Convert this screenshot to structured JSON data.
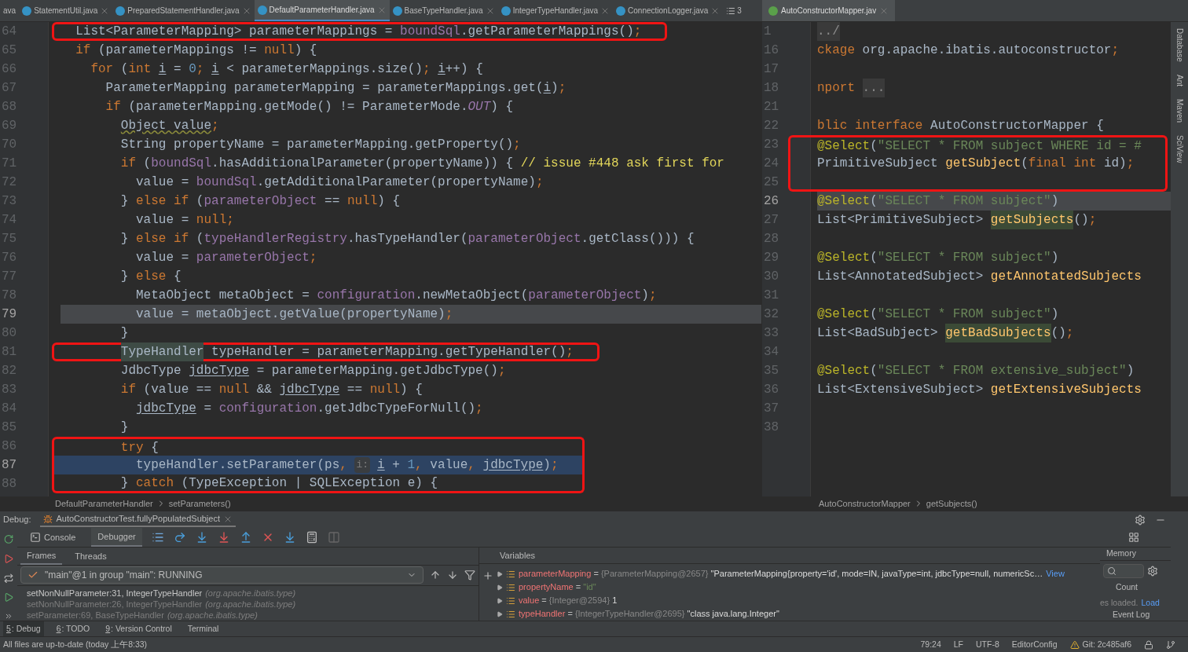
{
  "editor_tabs": [
    {
      "label": "ava",
      "selected": false,
      "icon": false
    },
    {
      "label": "StatementUtil.java",
      "selected": false,
      "icon": true
    },
    {
      "label": "PreparedStatementHandler.java",
      "selected": false,
      "icon": true
    },
    {
      "label": "DefaultParameterHandler.java",
      "selected": true,
      "icon": true
    },
    {
      "label": "BaseTypeHandler.java",
      "selected": false,
      "icon": true
    },
    {
      "label": "IntegerTypeHandler.java",
      "selected": false,
      "icon": true
    },
    {
      "label": "ConnectionLogger.java",
      "selected": false,
      "icon": true
    }
  ],
  "tabs_overflow": "3",
  "right_tab": {
    "label": "AutoConstructorMapper.jav",
    "selected": true
  },
  "left_editor": {
    "lines": [
      {
        "n": "64",
        "caret": false,
        "paused": false,
        "boxed": true,
        "tokens": [
          {
            "kind": "plain",
            "text": "List<ParameterMapping> parameterMappings = "
          },
          {
            "kind": "field",
            "text": "boundSql"
          },
          {
            "kind": "plain",
            "text": ".getParameterMappings()"
          },
          {
            "kind": "kw",
            "text": ";"
          }
        ]
      },
      {
        "n": "65",
        "caret": false,
        "paused": false,
        "boxed": false,
        "tokens": [
          {
            "kind": "kw",
            "text": "if"
          },
          {
            "kind": "plain",
            "text": " (parameterMappings != "
          },
          {
            "kind": "kw",
            "text": "null"
          },
          {
            "kind": "plain",
            "text": ") {"
          }
        ],
        "children": [
          {
            "n": "66",
            "caret": false,
            "paused": false,
            "boxed": false,
            "tokens": [
              {
                "kind": "kw",
                "text": "for"
              },
              {
                "kind": "plain",
                "text": " ("
              },
              {
                "kind": "kw",
                "text": "int "
              },
              {
                "kind": "uvar",
                "text": "i"
              },
              {
                "kind": "plain",
                "text": " = "
              },
              {
                "kind": "num",
                "text": "0"
              },
              {
                "kind": "kw",
                "text": "; "
              },
              {
                "kind": "uvar",
                "text": "i"
              },
              {
                "kind": "plain",
                "text": " < parameterMappings.size()"
              },
              {
                "kind": "kw",
                "text": "; "
              },
              {
                "kind": "uvar",
                "text": "i"
              },
              {
                "kind": "plain",
                "text": "++) {"
              }
            ],
            "children": [
              {
                "n": "67",
                "caret": false,
                "paused": false,
                "boxed": false,
                "tokens": [
                  {
                    "kind": "plain",
                    "text": "ParameterMapping parameterMapping = parameterMappings.get("
                  },
                  {
                    "kind": "uvar",
                    "text": "i"
                  },
                  {
                    "kind": "plain",
                    "text": ")"
                  },
                  {
                    "kind": "kw",
                    "text": ";"
                  }
                ]
              },
              {
                "n": "68",
                "caret": false,
                "paused": false,
                "boxed": false,
                "tokens": [
                  {
                    "kind": "kw",
                    "text": "if"
                  },
                  {
                    "kind": "plain",
                    "text": " (parameterMapping.getMode() != ParameterMode."
                  },
                  {
                    "kind": "fieldi",
                    "text": "OUT"
                  },
                  {
                    "kind": "plain",
                    "text": ") {"
                  }
                ],
                "children": [
                  {
                    "n": "69",
                    "caret": false,
                    "paused": false,
                    "boxed": false,
                    "tokens": [
                      {
                        "kind": "warn",
                        "text": "Object value"
                      },
                      {
                        "kind": "kw",
                        "text": ";"
                      }
                    ]
                  },
                  {
                    "n": "70",
                    "caret": false,
                    "paused": false,
                    "boxed": false,
                    "tokens": [
                      {
                        "kind": "plain",
                        "text": "String propertyName = parameterMapping.getProperty()"
                      },
                      {
                        "kind": "kw",
                        "text": ";"
                      }
                    ]
                  },
                  {
                    "n": "71",
                    "caret": false,
                    "paused": false,
                    "boxed": false,
                    "tokens": [
                      {
                        "kind": "kw",
                        "text": "if"
                      },
                      {
                        "kind": "plain",
                        "text": " ("
                      },
                      {
                        "kind": "field",
                        "text": "boundSql"
                      },
                      {
                        "kind": "plain",
                        "text": ".hasAdditionalParameter(propertyName)) { "
                      },
                      {
                        "kind": "todo",
                        "text": "// issue #448 ask first for"
                      }
                    ],
                    "children": [
                      {
                        "n": "72",
                        "caret": false,
                        "paused": false,
                        "boxed": false,
                        "tokens": [
                          {
                            "kind": "plain",
                            "text": "value = "
                          },
                          {
                            "kind": "field",
                            "text": "boundSql"
                          },
                          {
                            "kind": "plain",
                            "text": ".getAdditionalParameter(propertyName)"
                          },
                          {
                            "kind": "kw",
                            "text": ";"
                          }
                        ]
                      }
                    ]
                  },
                  {
                    "n": "73",
                    "caret": false,
                    "paused": false,
                    "boxed": false,
                    "tokens": [
                      {
                        "kind": "plain",
                        "text": "} "
                      },
                      {
                        "kind": "kw",
                        "text": "else if"
                      },
                      {
                        "kind": "plain",
                        "text": " ("
                      },
                      {
                        "kind": "field",
                        "text": "parameterObject"
                      },
                      {
                        "kind": "plain",
                        "text": " == "
                      },
                      {
                        "kind": "kw",
                        "text": "null"
                      },
                      {
                        "kind": "plain",
                        "text": ") {"
                      }
                    ],
                    "children": [
                      {
                        "n": "74",
                        "caret": false,
                        "paused": false,
                        "boxed": false,
                        "tokens": [
                          {
                            "kind": "plain",
                            "text": "value = "
                          },
                          {
                            "kind": "kw",
                            "text": "null;"
                          }
                        ]
                      }
                    ]
                  },
                  {
                    "n": "75",
                    "caret": false,
                    "paused": false,
                    "boxed": false,
                    "tokens": [
                      {
                        "kind": "plain",
                        "text": "} "
                      },
                      {
                        "kind": "kw",
                        "text": "else if"
                      },
                      {
                        "kind": "plain",
                        "text": " ("
                      },
                      {
                        "kind": "field",
                        "text": "typeHandlerRegistry"
                      },
                      {
                        "kind": "plain",
                        "text": ".hasTypeHandler("
                      },
                      {
                        "kind": "field",
                        "text": "parameterObject"
                      },
                      {
                        "kind": "plain",
                        "text": ".getClass())) {"
                      }
                    ],
                    "children": [
                      {
                        "n": "76",
                        "caret": false,
                        "paused": false,
                        "boxed": false,
                        "tokens": [
                          {
                            "kind": "plain",
                            "text": "value = "
                          },
                          {
                            "kind": "field",
                            "text": "parameterObject"
                          },
                          {
                            "kind": "kw",
                            "text": ";"
                          }
                        ]
                      }
                    ]
                  },
                  {
                    "n": "77",
                    "caret": false,
                    "paused": false,
                    "boxed": false,
                    "tokens": [
                      {
                        "kind": "plain",
                        "text": "} "
                      },
                      {
                        "kind": "kw",
                        "text": "else"
                      },
                      {
                        "kind": "plain",
                        "text": " {"
                      }
                    ],
                    "children": [
                      {
                        "n": "78",
                        "caret": false,
                        "paused": false,
                        "boxed": false,
                        "tokens": [
                          {
                            "kind": "plain",
                            "text": "MetaObject metaObject = "
                          },
                          {
                            "kind": "field",
                            "text": "configuration"
                          },
                          {
                            "kind": "plain",
                            "text": ".newMetaObject("
                          },
                          {
                            "kind": "field",
                            "text": "parameterObject"
                          },
                          {
                            "kind": "plain",
                            "text": ")"
                          },
                          {
                            "kind": "kw",
                            "text": ";"
                          }
                        ]
                      },
                      {
                        "n": "79",
                        "caret": true,
                        "paused": false,
                        "boxed": false,
                        "tokens": [
                          {
                            "kind": "plain",
                            "text": "value = metaObject.getValue(propertyName)"
                          },
                          {
                            "kind": "kw",
                            "text": ";"
                          }
                        ]
                      }
                    ]
                  },
                  {
                    "n": "80",
                    "caret": false,
                    "paused": false,
                    "boxed": false,
                    "tokens": [
                      {
                        "kind": "plain",
                        "text": "}"
                      }
                    ]
                  },
                  {
                    "n": "81",
                    "caret": false,
                    "paused": false,
                    "boxed": true,
                    "tokens": [
                      {
                        "kind": "hl",
                        "text": "TypeHandler"
                      },
                      {
                        "kind": "plain",
                        "text": " typeHandler = parameterMapping.getTypeHandler()"
                      },
                      {
                        "kind": "kw",
                        "text": ";"
                      }
                    ]
                  },
                  {
                    "n": "82",
                    "caret": false,
                    "paused": false,
                    "boxed": false,
                    "tokens": [
                      {
                        "kind": "plain",
                        "text": "JdbcType "
                      },
                      {
                        "kind": "uvar",
                        "text": "jdbcType"
                      },
                      {
                        "kind": "plain",
                        "text": " = parameterMapping.getJdbcType()"
                      },
                      {
                        "kind": "kw",
                        "text": ";"
                      }
                    ]
                  },
                  {
                    "n": "83",
                    "caret": false,
                    "paused": false,
                    "boxed": false,
                    "tokens": [
                      {
                        "kind": "kw",
                        "text": "if"
                      },
                      {
                        "kind": "plain",
                        "text": " (value == "
                      },
                      {
                        "kind": "kw",
                        "text": "null"
                      },
                      {
                        "kind": "plain",
                        "text": " && "
                      },
                      {
                        "kind": "uvar",
                        "text": "jdbcType"
                      },
                      {
                        "kind": "plain",
                        "text": " == "
                      },
                      {
                        "kind": "kw",
                        "text": "null"
                      },
                      {
                        "kind": "plain",
                        "text": ") {"
                      }
                    ],
                    "children": [
                      {
                        "n": "84",
                        "caret": false,
                        "paused": false,
                        "boxed": false,
                        "tokens": [
                          {
                            "kind": "uvar",
                            "text": "jdbcType"
                          },
                          {
                            "kind": "plain",
                            "text": " = "
                          },
                          {
                            "kind": "field",
                            "text": "configuration"
                          },
                          {
                            "kind": "plain",
                            "text": ".getJdbcTypeForNull()"
                          },
                          {
                            "kind": "kw",
                            "text": ";"
                          }
                        ]
                      }
                    ]
                  },
                  {
                    "n": "85",
                    "caret": false,
                    "paused": false,
                    "boxed": false,
                    "tokens": [
                      {
                        "kind": "plain",
                        "text": "}"
                      }
                    ]
                  },
                  {
                    "n": "86",
                    "caret": false,
                    "paused": false,
                    "boxed": true,
                    "tokens": [
                      {
                        "kind": "kw",
                        "text": "try"
                      },
                      {
                        "kind": "plain",
                        "text": " {"
                      }
                    ],
                    "children": [
                      {
                        "n": "87",
                        "caret": false,
                        "paused": true,
                        "boxed": true,
                        "tokens": [
                          {
                            "kind": "plain",
                            "text": "typeHandler.setParameter(ps"
                          },
                          {
                            "kind": "kw",
                            "text": ", "
                          },
                          {
                            "kind": "hint",
                            "text": "i:"
                          },
                          {
                            "kind": "uvar",
                            "text": "i"
                          },
                          {
                            "kind": "plain",
                            "text": " + "
                          },
                          {
                            "kind": "num",
                            "text": "1"
                          },
                          {
                            "kind": "kw",
                            "text": ", "
                          },
                          {
                            "kind": "plain",
                            "text": "value"
                          },
                          {
                            "kind": "kw",
                            "text": ", "
                          },
                          {
                            "kind": "uvar",
                            "text": "jdbcType"
                          },
                          {
                            "kind": "plain",
                            "text": ")"
                          },
                          {
                            "kind": "kw",
                            "text": ";"
                          }
                        ]
                      }
                    ]
                  },
                  {
                    "n": "88",
                    "caret": false,
                    "paused": false,
                    "boxed": true,
                    "tokens": [
                      {
                        "kind": "plain",
                        "text": "} "
                      },
                      {
                        "kind": "kw",
                        "text": "catch"
                      },
                      {
                        "kind": "plain",
                        "text": " (TypeException | SQLException e) {"
                      }
                    ]
                  }
                ]
              }
            ]
          }
        ]
      }
    ],
    "breadcrumb": [
      "DefaultParameterHandler",
      "setParameters()"
    ]
  },
  "right_editor": {
    "lines": [
      {
        "n": "1",
        "caret": false,
        "paused": false,
        "boxed": false,
        "tokens": [
          {
            "kind": "fold",
            "text": "../"
          }
        ]
      },
      {
        "n": "16",
        "caret": false,
        "paused": false,
        "boxed": false,
        "tokens": [
          {
            "kind": "kw",
            "text": "ckage"
          },
          {
            "kind": "plain",
            "text": " org.apache.ibatis.autoconstructor"
          },
          {
            "kind": "kw",
            "text": ";"
          }
        ]
      },
      {
        "n": "17"
      },
      {
        "n": "18",
        "caret": false,
        "paused": false,
        "boxed": false,
        "tokens": [
          {
            "kind": "kw",
            "text": "nport "
          },
          {
            "kind": "fold",
            "text": "..."
          }
        ]
      },
      {
        "n": "21"
      },
      {
        "n": "22",
        "caret": false,
        "paused": false,
        "boxed": false,
        "tokens": [
          {
            "kind": "kw",
            "text": "blic interface"
          },
          {
            "kind": "plain",
            "text": " AutoConstructorMapper {"
          }
        ]
      },
      {
        "n": "23",
        "caret": false,
        "paused": false,
        "boxed": true,
        "tokens": [
          {
            "kind": "ann",
            "text": "@Select"
          },
          {
            "kind": "plain",
            "text": "("
          },
          {
            "kind": "str",
            "text": "\"SELECT * FROM subject WHERE id = #"
          }
        ]
      },
      {
        "n": "24",
        "caret": false,
        "paused": false,
        "boxed": true,
        "tokens": [
          {
            "kind": "plain",
            "text": "PrimitiveSubject "
          },
          {
            "kind": "method",
            "text": "getSubject"
          },
          {
            "kind": "plain",
            "text": "("
          },
          {
            "kind": "kw",
            "text": "final int"
          },
          {
            "kind": "plain",
            "text": " id)"
          },
          {
            "kind": "kw",
            "text": ";"
          }
        ]
      },
      {
        "n": "25",
        "boxed": true
      },
      {
        "n": "26",
        "caret": true,
        "paused": false,
        "boxed": false,
        "tokens": [
          {
            "kind": "ann",
            "text": "@Select"
          },
          {
            "kind": "plain",
            "text": "("
          },
          {
            "kind": "str",
            "text": "\"SELECT * FROM subject\""
          },
          {
            "kind": "plain",
            "text": ")"
          }
        ]
      },
      {
        "n": "27",
        "caret": false,
        "paused": false,
        "boxed": false,
        "tokens": [
          {
            "kind": "plain",
            "text": "List<PrimitiveSubject> "
          },
          {
            "kind": "methodhl",
            "text": "getSubjects"
          },
          {
            "kind": "plain",
            "text": "()"
          },
          {
            "kind": "kw",
            "text": ";"
          }
        ]
      },
      {
        "n": "28"
      },
      {
        "n": "29",
        "caret": false,
        "paused": false,
        "boxed": false,
        "tokens": [
          {
            "kind": "ann",
            "text": "@Select"
          },
          {
            "kind": "plain",
            "text": "("
          },
          {
            "kind": "str",
            "text": "\"SELECT * FROM subject\""
          },
          {
            "kind": "plain",
            "text": ")"
          }
        ]
      },
      {
        "n": "30",
        "caret": false,
        "paused": false,
        "boxed": false,
        "tokens": [
          {
            "kind": "plain",
            "text": "List<AnnotatedSubject> "
          },
          {
            "kind": "method",
            "text": "getAnnotatedSubjects"
          }
        ]
      },
      {
        "n": "31"
      },
      {
        "n": "32",
        "caret": false,
        "paused": false,
        "boxed": false,
        "tokens": [
          {
            "kind": "ann",
            "text": "@Select"
          },
          {
            "kind": "plain",
            "text": "("
          },
          {
            "kind": "str",
            "text": "\"SELECT * FROM subject\""
          },
          {
            "kind": "plain",
            "text": ")"
          }
        ]
      },
      {
        "n": "33",
        "caret": false,
        "paused": false,
        "boxed": false,
        "tokens": [
          {
            "kind": "plain",
            "text": "List<BadSubject> "
          },
          {
            "kind": "methodhl",
            "text": "getBadSubjects"
          },
          {
            "kind": "plain",
            "text": "()"
          },
          {
            "kind": "kw",
            "text": ";"
          }
        ]
      },
      {
        "n": "34"
      },
      {
        "n": "35",
        "caret": false,
        "paused": false,
        "boxed": false,
        "tokens": [
          {
            "kind": "ann",
            "text": "@Select"
          },
          {
            "kind": "plain",
            "text": "("
          },
          {
            "kind": "str",
            "text": "\"SELECT * FROM extensive_subject\""
          },
          {
            "kind": "plain",
            "text": ")"
          }
        ]
      },
      {
        "n": "36",
        "caret": false,
        "paused": false,
        "boxed": false,
        "tokens": [
          {
            "kind": "plain",
            "text": "List<ExtensiveSubject> "
          },
          {
            "kind": "method",
            "text": "getExtensiveSubjects"
          }
        ]
      },
      {
        "n": "37"
      },
      {
        "n": "38"
      }
    ],
    "breadcrumb": [
      "AutoConstructorMapper",
      "getSubjects()"
    ]
  },
  "side_tools": [
    "Database",
    "Ant",
    "Maven",
    "SciView"
  ],
  "debug": {
    "label": "Debug:",
    "session": "AutoConstructorTest.fullyPopulatedSubject",
    "tabs": [
      {
        "label": "Console",
        "selected": false
      },
      {
        "label": "Debugger",
        "selected": true
      }
    ],
    "frame_tabs": [
      {
        "label": "Frames",
        "selected": true
      },
      {
        "label": "Threads",
        "selected": false
      }
    ],
    "thread": "\"main\"@1 in group \"main\": RUNNING",
    "frames": [
      {
        "method": "setNonNullParameter:31, IntegerTypeHandler",
        "package": "(org.apache.ibatis.type)",
        "selected": true
      },
      {
        "method": "setNonNullParameter:26, IntegerTypeHandler",
        "package": "(org.apache.ibatis.type)",
        "selected": false
      },
      {
        "method": "setParameter:69, BaseTypeHandler",
        "package": "(org.apache.ibatis.type)",
        "selected": false
      }
    ],
    "variables_title": "Variables",
    "variables": [
      {
        "name": "parameterMapping",
        "assign": "=",
        "ref": "{ParameterMapping@2657}",
        "value": "\"ParameterMapping{property='id', mode=IN, javaType=int, jdbcType=null, numericSc…",
        "kind": "object",
        "link": "View"
      },
      {
        "name": "propertyName",
        "assign": "=",
        "value": "\"id\"",
        "kind": "string"
      },
      {
        "name": "value",
        "assign": "=",
        "ref": "{Integer@2594}",
        "value": "1",
        "kind": "object"
      },
      {
        "name": "typeHandler",
        "assign": "=",
        "ref": "{IntegerTypeHandler@2695}",
        "value": "\"class java.lang.Integer\"",
        "kind": "object"
      }
    ],
    "memory": {
      "title": "Memory",
      "column": "Count",
      "status": "es loaded.",
      "link": "Load",
      "event_log": "Event Log"
    }
  },
  "tool_windows": [
    {
      "key": "5",
      "label": ": Debug",
      "selected": true
    },
    {
      "key": "6",
      "label": ": TODO",
      "selected": false
    },
    {
      "key": "9",
      "label": ": Version Control",
      "selected": false
    },
    {
      "label": "Terminal",
      "selected": false
    }
  ],
  "status_bar": {
    "message": "All files are up-to-date (today 上午8:33)",
    "position": "79:24",
    "line_sep": "LF",
    "encoding": "UTF-8",
    "config": "EditorConfig",
    "git": "Git: 2c485af6"
  }
}
